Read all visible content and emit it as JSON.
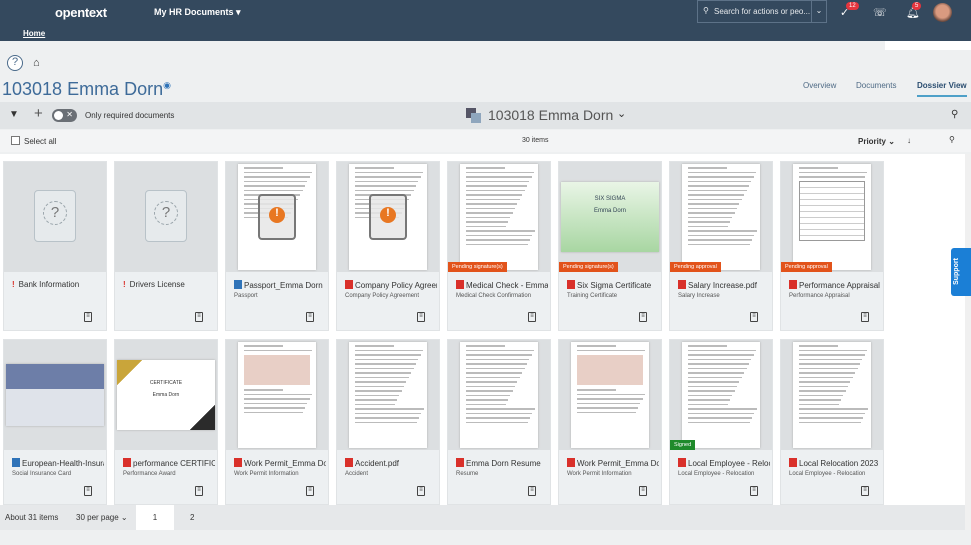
{
  "header": {
    "logo": "opentext",
    "app_menu": "My HR Documents",
    "home_link": "Home",
    "search_placeholder": "Search for actions or peo...",
    "tasks_badge": "12",
    "notifications_badge": "5"
  },
  "page": {
    "title": "103018 Emma Dorn",
    "tabs": [
      "Overview",
      "Documents",
      "Dossier View"
    ],
    "active_tab": "Dossier View"
  },
  "toolbar": {
    "toggle_label": "Only required documents",
    "toggle_state": "off",
    "dossier_name": "103018 Emma Dorn",
    "select_all": "Select all",
    "item_count": "30 items",
    "sort_label": "Priority"
  },
  "colors": {
    "header": "#34495e",
    "pending": "#e2531b",
    "signed": "#1f8a2b",
    "pdf": "#d9302a",
    "doc": "#2f73b8",
    "accent": "#1b7fd6"
  },
  "cards": [
    {
      "name": "Bank Information",
      "type": "",
      "icon": "missing",
      "thumb": "placeholder",
      "status": ""
    },
    {
      "name": "Drivers License",
      "type": "",
      "icon": "missing",
      "thumb": "placeholder",
      "status": ""
    },
    {
      "name": "Passport_Emma Dorn",
      "type": "Passport",
      "icon": "doc",
      "thumb": "warning",
      "status": ""
    },
    {
      "name": "Company Policy Agreement",
      "type": "Company Policy Agreement",
      "icon": "pdf",
      "thumb": "warning",
      "status": ""
    },
    {
      "name": "Medical Check - Emma Dorn",
      "type": "Medical Check Confirmation",
      "icon": "pdf",
      "thumb": "page",
      "status": "Pending signature(s)"
    },
    {
      "name": "Six Sigma Certificate",
      "type": "Training Certificate",
      "icon": "pdf",
      "thumb": "green-cert",
      "status": "Pending signature(s)"
    },
    {
      "name": "Salary Increase.pdf",
      "type": "Salary Increase",
      "icon": "pdf",
      "thumb": "page",
      "status": "Pending approval"
    },
    {
      "name": "Performance Appraisal",
      "type": "Performance Appraisal",
      "icon": "pdf",
      "thumb": "form",
      "status": "Pending approval"
    },
    {
      "name": "European-Health-Insurance",
      "type": "Social Insurance Card",
      "icon": "doc",
      "thumb": "card",
      "status": ""
    },
    {
      "name": "performance CERTIFICATE",
      "type": "Performance Award",
      "icon": "pdf",
      "thumb": "gold-cert",
      "status": ""
    },
    {
      "name": "Work Permit_Emma Dorn",
      "type": "Work Permit Information",
      "icon": "pdf",
      "thumb": "id",
      "status": ""
    },
    {
      "name": "Accident.pdf",
      "type": "Accident",
      "icon": "pdf",
      "thumb": "page",
      "status": ""
    },
    {
      "name": "Emma Dorn Resume",
      "type": "Resume",
      "icon": "pdf",
      "thumb": "page",
      "status": ""
    },
    {
      "name": "Work Permit_Emma Dorn",
      "type": "Work Permit Information",
      "icon": "pdf",
      "thumb": "id",
      "status": ""
    },
    {
      "name": "Local Employee - Relocation",
      "type": "Local Employee - Relocation",
      "icon": "pdf",
      "thumb": "page",
      "status": "Signed"
    },
    {
      "name": "Local Relocation 2023",
      "type": "Local Employee - Relocation",
      "icon": "pdf",
      "thumb": "page",
      "status": ""
    }
  ],
  "footer": {
    "total": "About 31 items",
    "per_page": "30 per page",
    "pages": [
      "1",
      "2"
    ],
    "current_page": "1"
  },
  "support_label": "Support"
}
